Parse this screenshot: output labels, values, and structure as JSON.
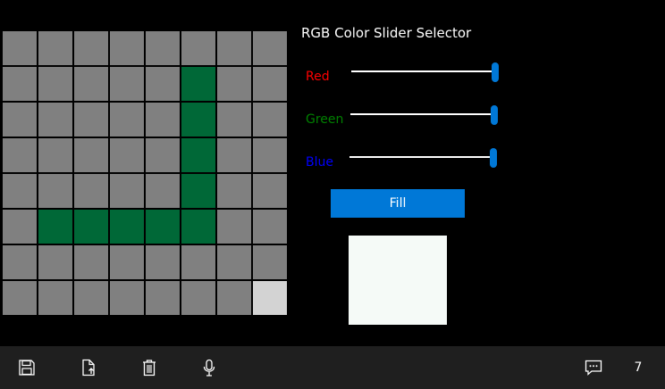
{
  "window_title": "RGB Color Slider Selector",
  "grid": {
    "rows": 8,
    "cols": 8,
    "cells": [
      "g",
      "g",
      "g",
      "g",
      "g",
      "g",
      "g",
      "g",
      "g",
      "g",
      "g",
      "g",
      "g",
      "G",
      "g",
      "g",
      "g",
      "g",
      "g",
      "g",
      "g",
      "G",
      "g",
      "g",
      "g",
      "g",
      "g",
      "g",
      "g",
      "G",
      "g",
      "g",
      "g",
      "g",
      "g",
      "g",
      "g",
      "G",
      "g",
      "g",
      "g",
      "G",
      "G",
      "G",
      "G",
      "G",
      "g",
      "g",
      "g",
      "g",
      "g",
      "g",
      "g",
      "g",
      "g",
      "g",
      "g",
      "g",
      "g",
      "g",
      "g",
      "g",
      "g",
      "L"
    ],
    "colors": {
      "g": "#808080",
      "G": "#006837",
      "L": "#d3d3d3"
    }
  },
  "sliders": [
    {
      "label": "Red",
      "color": "#ff0000",
      "value": 1.0
    },
    {
      "label": "Green",
      "color": "#008000",
      "value": 1.0
    },
    {
      "label": "Blue",
      "color": "#0000ff",
      "value": 1.0
    }
  ],
  "accent_color": "#0078d7",
  "fill_button": {
    "label": "Fill"
  },
  "preview_color": "#f5faf7",
  "appbar": {
    "buttons": [
      {
        "icon": "save-icon"
      },
      {
        "icon": "export-icon"
      },
      {
        "icon": "delete-icon"
      },
      {
        "icon": "microphone-icon"
      },
      {
        "icon": "feedback-icon"
      }
    ],
    "count": "7"
  }
}
